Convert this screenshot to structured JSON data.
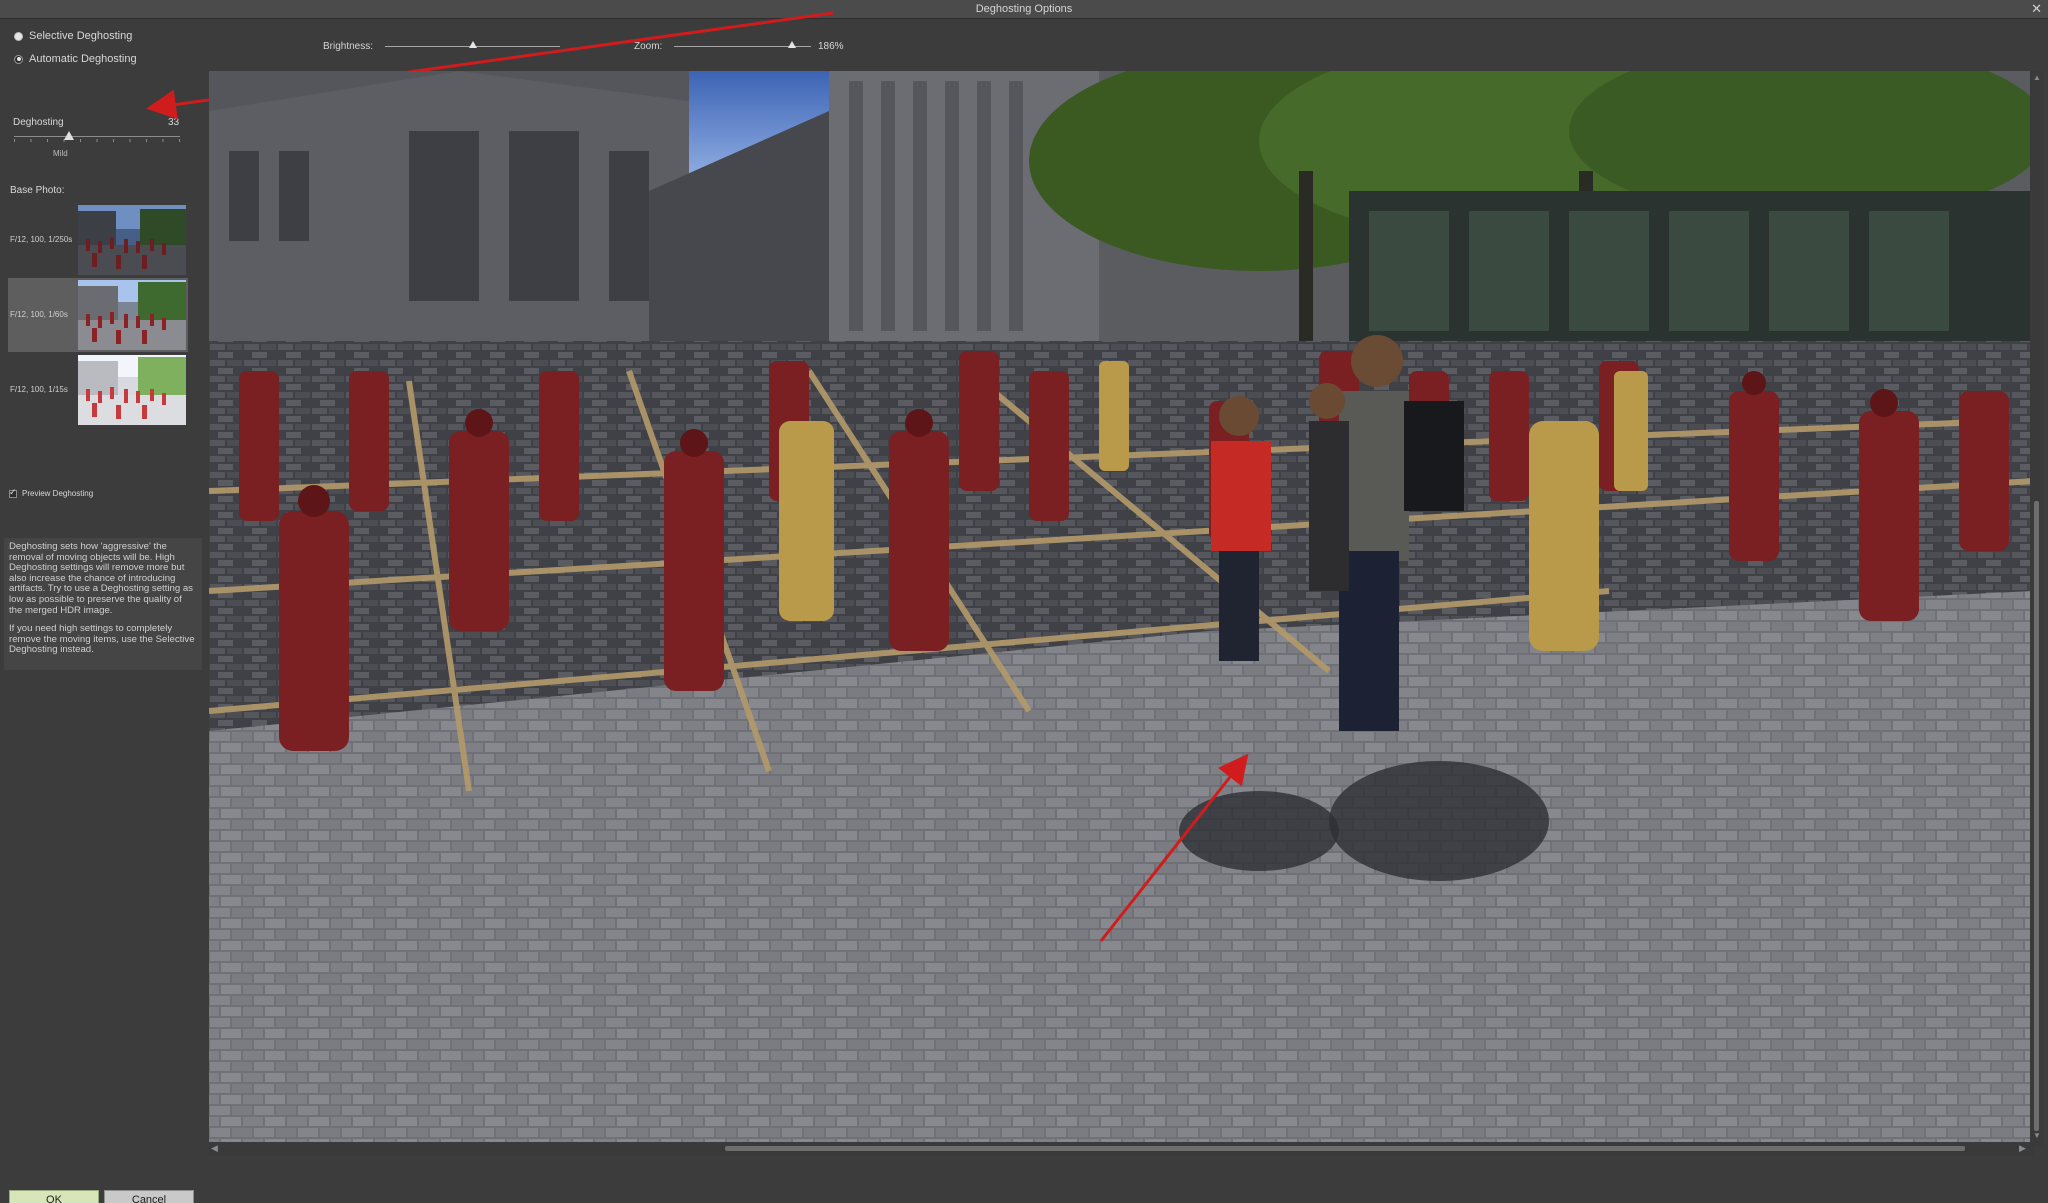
{
  "window": {
    "title": "Deghosting Options"
  },
  "mode": {
    "options": [
      {
        "label": "Selective Deghosting",
        "selected": false
      },
      {
        "label": "Automatic Deghosting",
        "selected": true
      }
    ]
  },
  "deghosting": {
    "label": "Deghosting",
    "value": "33",
    "level_label": "Mild",
    "level_fraction": 0.33
  },
  "base_photo": {
    "label": "Base Photo:",
    "items": [
      {
        "caption": "F/12, 100, 1/250s",
        "selected": false
      },
      {
        "caption": "F/12, 100, 1/60s",
        "selected": true
      },
      {
        "caption": "F/12, 100, 1/15s",
        "selected": false
      }
    ]
  },
  "preview_toggle": {
    "label": "Preview Deghosting",
    "checked": true
  },
  "info": {
    "paragraph1": "Deghosting sets how 'aggressive' the removal of moving objects will be. High Deghosting settings will remove more but also increase the chance of introducing artifacts. Try to use a Deghosting setting as low as possible to preserve the quality of the merged HDR image.",
    "paragraph2": "If you need high settings to completely remove the moving items, use the Selective Deghosting instead."
  },
  "toolbar": {
    "brightness_label": "Brightness:",
    "brightness_level": 0.5,
    "zoom_label": "Zoom:",
    "zoom_value": "186%",
    "zoom_level": 0.86
  },
  "buttons": {
    "ok": "OK",
    "cancel": "Cancel"
  },
  "colors": {
    "statue_red": "#7a1f22",
    "statue_gold": "#b89a4a",
    "annotation_arrow": "#d01c1c",
    "ok_button": "#d7e6b8"
  }
}
